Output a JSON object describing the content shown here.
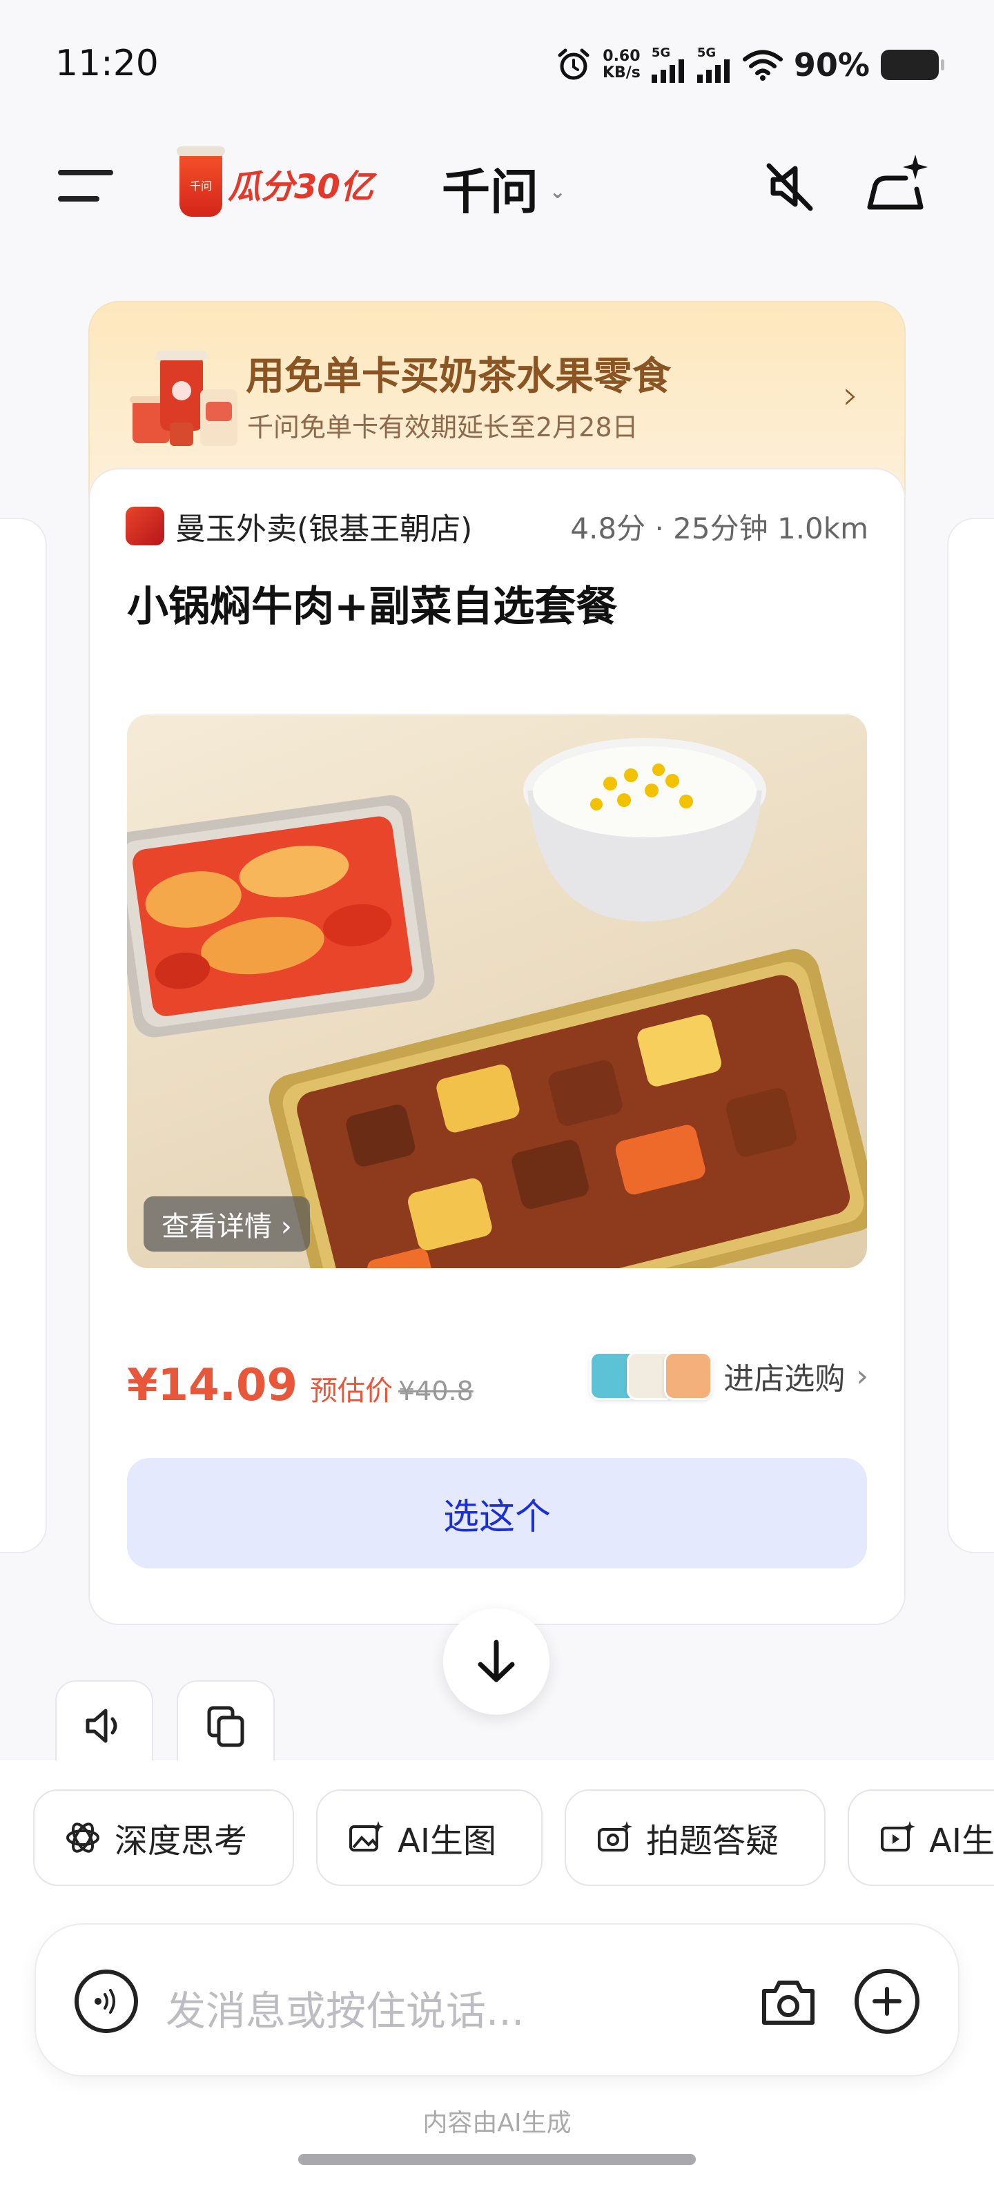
{
  "status_bar": {
    "time": "11:20",
    "net_speed_value": "0.60",
    "net_speed_unit": "KB/s",
    "signal_1": "5G",
    "signal_2": "5G",
    "battery": "90%"
  },
  "header": {
    "promo_label": "瓜分30亿",
    "cup_label": "千问",
    "title": "千问",
    "title_chevron": "⌄"
  },
  "banner": {
    "title": "用免单卡买奶茶水果零食",
    "subtitle": "千问免单卡有效期延长至2月28日",
    "arrow": "›"
  },
  "card": {
    "shop_name": "曼玉外卖(银基王朝店)",
    "shop_meta": "4.8分 · 25分钟 1.0km",
    "dish_title": "小锅焖牛肉+副菜自选套餐",
    "detail_label": "查看详情 ›",
    "price": "¥14.09",
    "price_label": "预估价",
    "original_price": "¥40.8",
    "store_link": "进店选购",
    "store_arrow": "›",
    "select_label": "选这个"
  },
  "chips": [
    {
      "label": "深度思考",
      "icon": "atom-icon"
    },
    {
      "label": "AI生图",
      "icon": "image-sparkle-icon"
    },
    {
      "label": "拍题答疑",
      "icon": "camera-sparkle-icon"
    },
    {
      "label": "AI生",
      "icon": "video-sparkle-icon"
    }
  ],
  "input": {
    "placeholder": "发消息或按住说话..."
  },
  "footer_note": "内容由AI生成",
  "colors": {
    "accent_blue": "#1c2fd6",
    "select_bg": "#e5e9fd",
    "price_orange": "#e8573a",
    "banner_brown": "#8a5423"
  }
}
